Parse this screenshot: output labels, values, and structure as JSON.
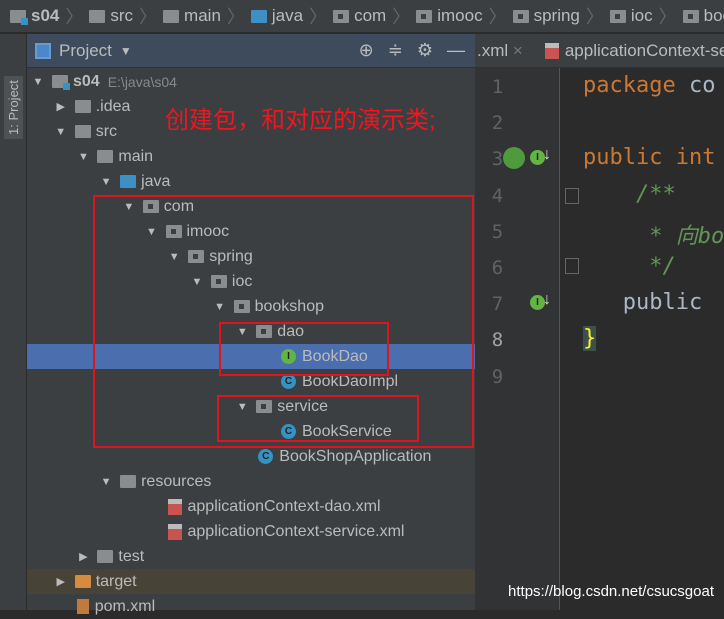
{
  "breadcrumb": [
    "s04",
    "src",
    "main",
    "java",
    "com",
    "imooc",
    "spring",
    "ioc",
    "bookshop"
  ],
  "side_stripe": {
    "label": "1: Project"
  },
  "project_panel": {
    "title": "Project",
    "tools": [
      "locate-icon",
      "collapse-icon",
      "gear-icon",
      "minimize-icon"
    ]
  },
  "tree": [
    {
      "label": "s04",
      "path": "E:\\java\\s04",
      "level": 0,
      "arrow": "down",
      "icon": "module"
    },
    {
      "label": ".idea",
      "level": 1,
      "arrow": "right",
      "icon": "folder"
    },
    {
      "label": "src",
      "level": 1,
      "arrow": "down",
      "icon": "folder"
    },
    {
      "label": "main",
      "level": 2,
      "arrow": "down",
      "icon": "folder"
    },
    {
      "label": "java",
      "level": 3,
      "arrow": "down",
      "icon": "src"
    },
    {
      "label": "com",
      "level": 4,
      "arrow": "down",
      "icon": "pkg"
    },
    {
      "label": "imooc",
      "level": 5,
      "arrow": "down",
      "icon": "pkg"
    },
    {
      "label": "spring",
      "level": 6,
      "arrow": "down",
      "icon": "pkg"
    },
    {
      "label": "ioc",
      "level": 7,
      "arrow": "down",
      "icon": "pkg"
    },
    {
      "label": "bookshop",
      "level": 8,
      "arrow": "down",
      "icon": "pkg"
    },
    {
      "label": "dao",
      "level": 9,
      "arrow": "down",
      "icon": "pkg"
    },
    {
      "label": "BookDao",
      "level": 10,
      "arrow": "",
      "icon": "interface",
      "selected": true
    },
    {
      "label": "BookDaoImpl",
      "level": 10,
      "arrow": "",
      "icon": "class"
    },
    {
      "label": "service",
      "level": 9,
      "arrow": "down",
      "icon": "pkg"
    },
    {
      "label": "BookService",
      "level": 10,
      "arrow": "",
      "icon": "class"
    },
    {
      "label": "BookShopApplication",
      "level": 9,
      "arrow": "",
      "icon": "class"
    },
    {
      "label": "resources",
      "level": 3,
      "arrow": "down",
      "icon": "res"
    },
    {
      "label": "applicationContext-dao.xml",
      "level": 5,
      "arrow": "",
      "icon": "xml"
    },
    {
      "label": "applicationContext-service.xml",
      "level": 5,
      "arrow": "",
      "icon": "xml"
    },
    {
      "label": "test",
      "level": 2,
      "arrow": "right",
      "icon": "folder"
    },
    {
      "label": "target",
      "level": 1,
      "arrow": "right",
      "icon": "target",
      "highlight": true
    },
    {
      "label": "pom.xml",
      "level": 1,
      "arrow": "",
      "icon": "maven"
    }
  ],
  "annotation": "创建包，和对应的演示类;",
  "editor": {
    "tabs": [
      {
        "label": ".xml",
        "close": "×"
      },
      {
        "label": "applicationContext-se"
      }
    ],
    "lines": [
      [
        {
          "t": "package ",
          "c": "kw"
        },
        {
          "t": "co",
          "c": "pl"
        }
      ],
      [],
      [
        {
          "t": "public ",
          "c": "kw"
        },
        {
          "t": "int",
          "c": "kw"
        }
      ],
      [
        {
          "t": "    /**",
          "c": "cm"
        }
      ],
      [
        {
          "t": "     * 向bo",
          "c": "cm"
        }
      ],
      [
        {
          "t": "     */",
          "c": "cm"
        }
      ],
      [
        {
          "t": "   public",
          "c": "pl"
        }
      ],
      [
        {
          "t": "}",
          "c": "brace"
        }
      ],
      []
    ]
  },
  "watermark": "https://blog.csdn.net/csucsgoat"
}
